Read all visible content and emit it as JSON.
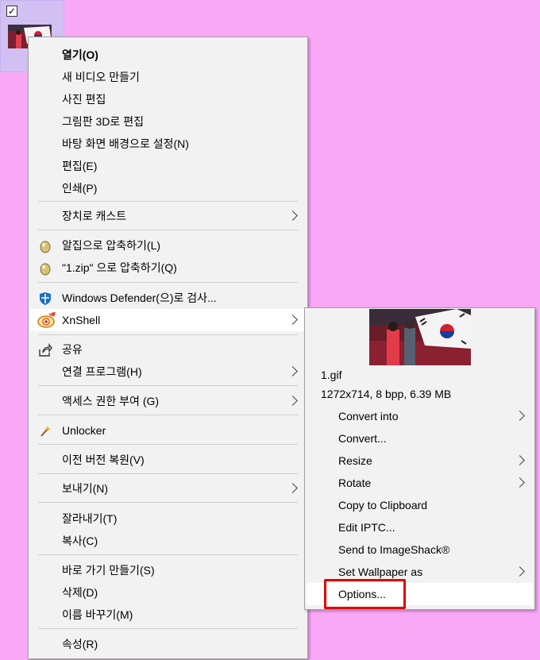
{
  "desktop": {
    "checkbox_mark": "✓"
  },
  "menu": {
    "items": {
      "open": "열기(O)",
      "new_video": "새 비디오 만들기",
      "edit_photo": "사진 편집",
      "paint3d": "그림판 3D로 편집",
      "set_bg": "바탕 화면 배경으로 설정(N)",
      "edit": "편집(E)",
      "print": "인쇄(P)",
      "cast": "장치로 캐스트",
      "alzip": "알집으로 압축하기(L)",
      "alzip_zip": "\"1.zip\" 으로 압축하기(Q)",
      "defender": "Windows Defender(으)로 검사...",
      "xnshell": "XnShell",
      "share": "공유",
      "open_with": "연결 프로그램(H)",
      "access": "액세스 권한 부여 (G)",
      "unlocker": "Unlocker",
      "restore": "이전 버전 복원(V)",
      "send_to": "보내기(N)",
      "cut": "잘라내기(T)",
      "copy": "복사(C)",
      "shortcut": "바로 가기 만들기(S)",
      "delete": "삭제(D)",
      "rename": "이름 바꾸기(M)",
      "properties": "속성(R)"
    }
  },
  "submenu": {
    "file_name": "1.gif",
    "file_info": "1272x714, 8 bpp, 6.39 MB",
    "items": {
      "convert_into": "Convert into",
      "convert": "Convert...",
      "resize": "Resize",
      "rotate": "Rotate",
      "copy_clipboard": "Copy to Clipboard",
      "edit_iptc": "Edit IPTC...",
      "imageshack": "Send to ImageShack®",
      "wallpaper": "Set Wallpaper as",
      "options": "Options..."
    }
  },
  "icons": {
    "alzip": "alzip-egg-icon",
    "defender": "shield-icon",
    "xnshell": "xnview-icon",
    "share": "share-icon",
    "unlocker": "wand-icon"
  },
  "colors": {
    "desktop": "#f9a8f6",
    "highlight": "#e00000"
  }
}
